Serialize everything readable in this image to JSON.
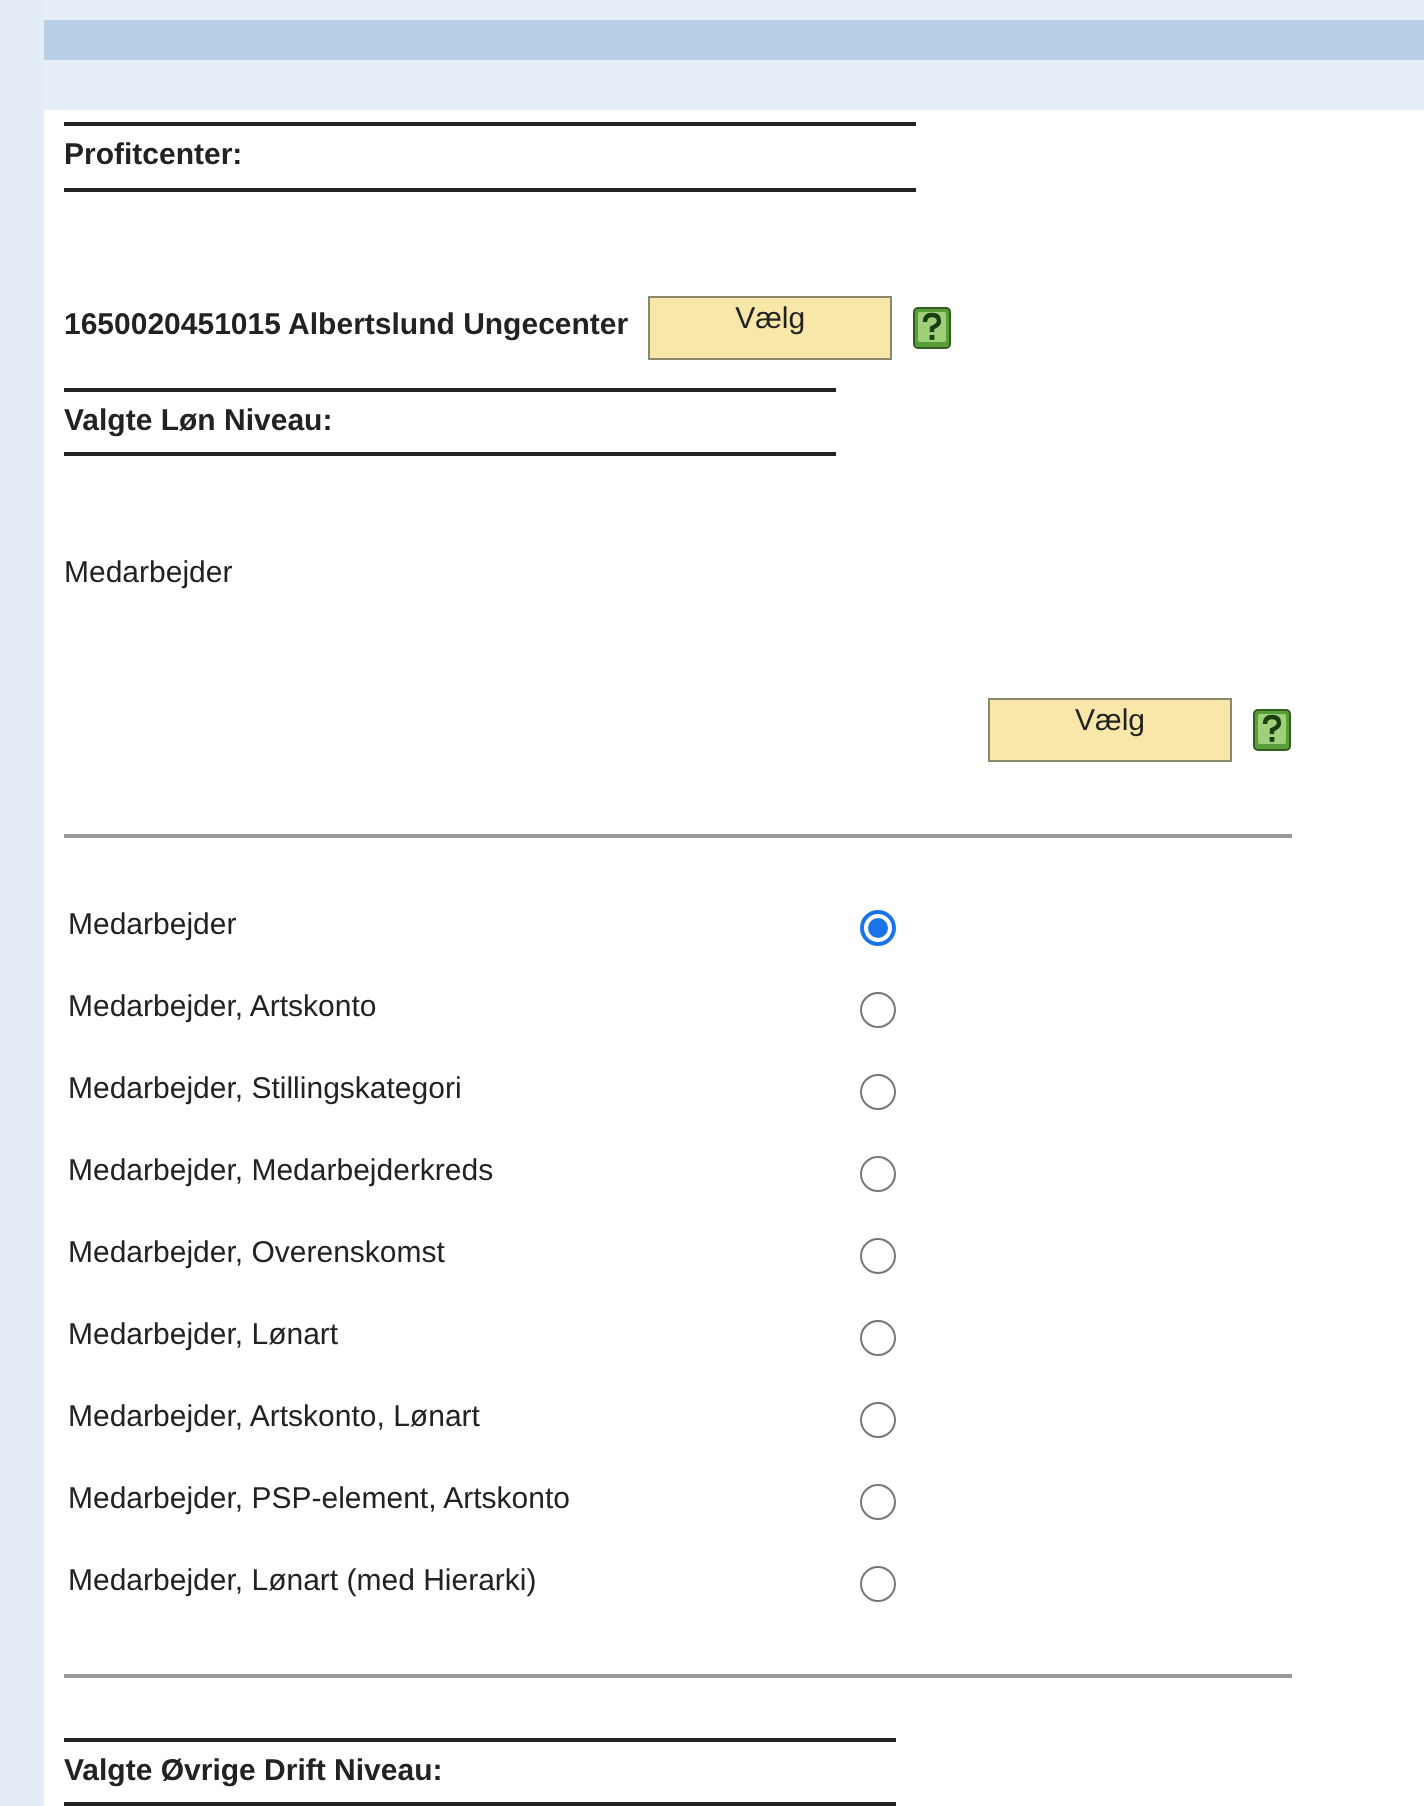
{
  "profitcenter": {
    "heading": "Profitcenter:",
    "value": "1650020451015 Albertslund Ungecenter",
    "button": "Vælg"
  },
  "loen_niveau": {
    "heading": "Valgte Løn Niveau:",
    "value": "Medarbejder",
    "button": "Vælg"
  },
  "options": [
    {
      "label": "Medarbejder",
      "selected": true
    },
    {
      "label": "Medarbejder, Artskonto",
      "selected": false
    },
    {
      "label": "Medarbejder, Stillingskategori",
      "selected": false
    },
    {
      "label": "Medarbejder, Medarbejderkreds",
      "selected": false
    },
    {
      "label": "Medarbejder, Overenskomst",
      "selected": false
    },
    {
      "label": "Medarbejder, Lønart",
      "selected": false
    },
    {
      "label": "Medarbejder, Artskonto, Lønart",
      "selected": false
    },
    {
      "label": "Medarbejder, PSP-element, Artskonto",
      "selected": false
    },
    {
      "label": "Medarbejder, Lønart (med Hierarki)",
      "selected": false
    }
  ],
  "drift_niveau": {
    "heading": "Valgte Øvrige Drift Niveau:"
  }
}
